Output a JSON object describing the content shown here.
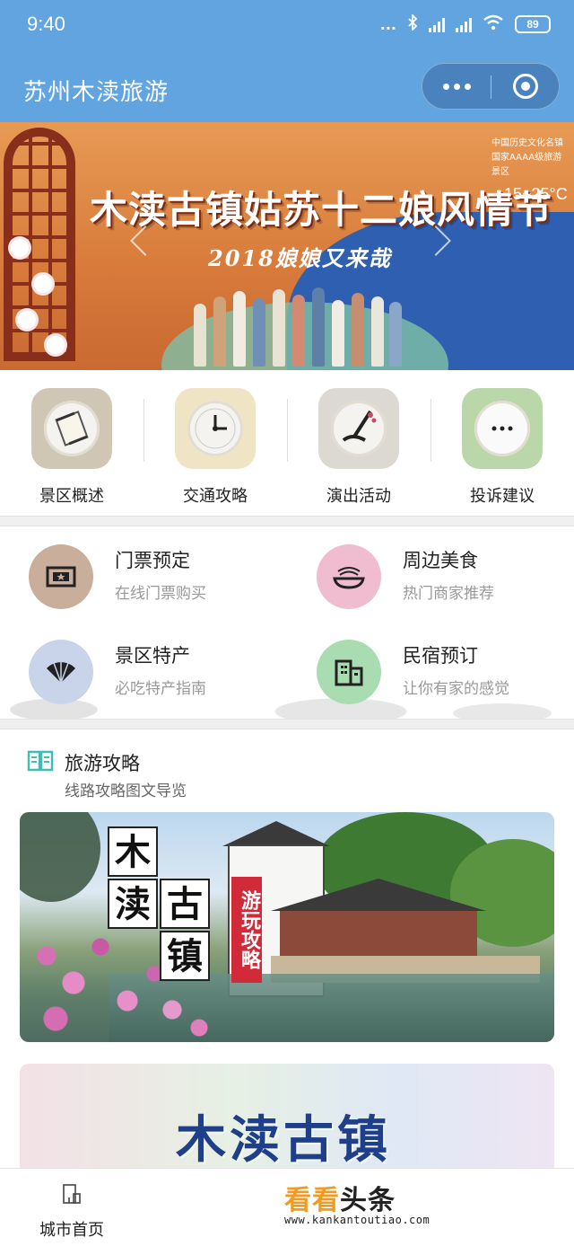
{
  "status": {
    "time": "9:40",
    "dots": "...",
    "battery": "89"
  },
  "header": {
    "title": "苏州木渎旅游"
  },
  "banner": {
    "title": "木渎古镇姑苏十二娘风情节",
    "subtitle": "2018娘娘又来哉",
    "temperature": "15~25°C",
    "org_line1": "中国历史文化名镇",
    "org_line2": "国家AAAA级旅游景区"
  },
  "quick_nav": [
    {
      "label": "景区概述",
      "icon": "scroll-icon",
      "tile_color": "#cfc6b4"
    },
    {
      "label": "交通攻略",
      "icon": "clock-icon",
      "tile_color": "#efe4c4"
    },
    {
      "label": "演出活动",
      "icon": "brush-icon",
      "tile_color": "#dcd8d2"
    },
    {
      "label": "投诉建议",
      "icon": "speech-bubble-icon",
      "tile_color": "#b9d7a8"
    }
  ],
  "services": [
    {
      "title": "门票预定",
      "subtitle": "在线门票购买",
      "icon": "ticket-icon",
      "color": "#c9ae9b"
    },
    {
      "title": "周边美食",
      "subtitle": "热门商家推荐",
      "icon": "noodle-bowl-icon",
      "color": "#efbcd0"
    },
    {
      "title": "景区特产",
      "subtitle": "必吃特产指南",
      "icon": "folding-fan-icon",
      "color": "#c9d4ea"
    },
    {
      "title": "民宿预订",
      "subtitle": "让你有家的感觉",
      "icon": "building-icon",
      "color": "#a9dcb0"
    }
  ],
  "guide": {
    "title": "旅游攻略",
    "subtitle": "线路攻略图文导览",
    "card1": {
      "chars": [
        "木",
        "渎",
        "古",
        "镇"
      ],
      "tag": "游玩攻略"
    },
    "card2": {
      "title": "木渎古镇"
    }
  },
  "tabbar": {
    "home_label": "城市首页"
  },
  "watermark": {
    "brand_orange": "看看",
    "brand_dark": "头条",
    "url": "www.kankantoutiao.com"
  }
}
